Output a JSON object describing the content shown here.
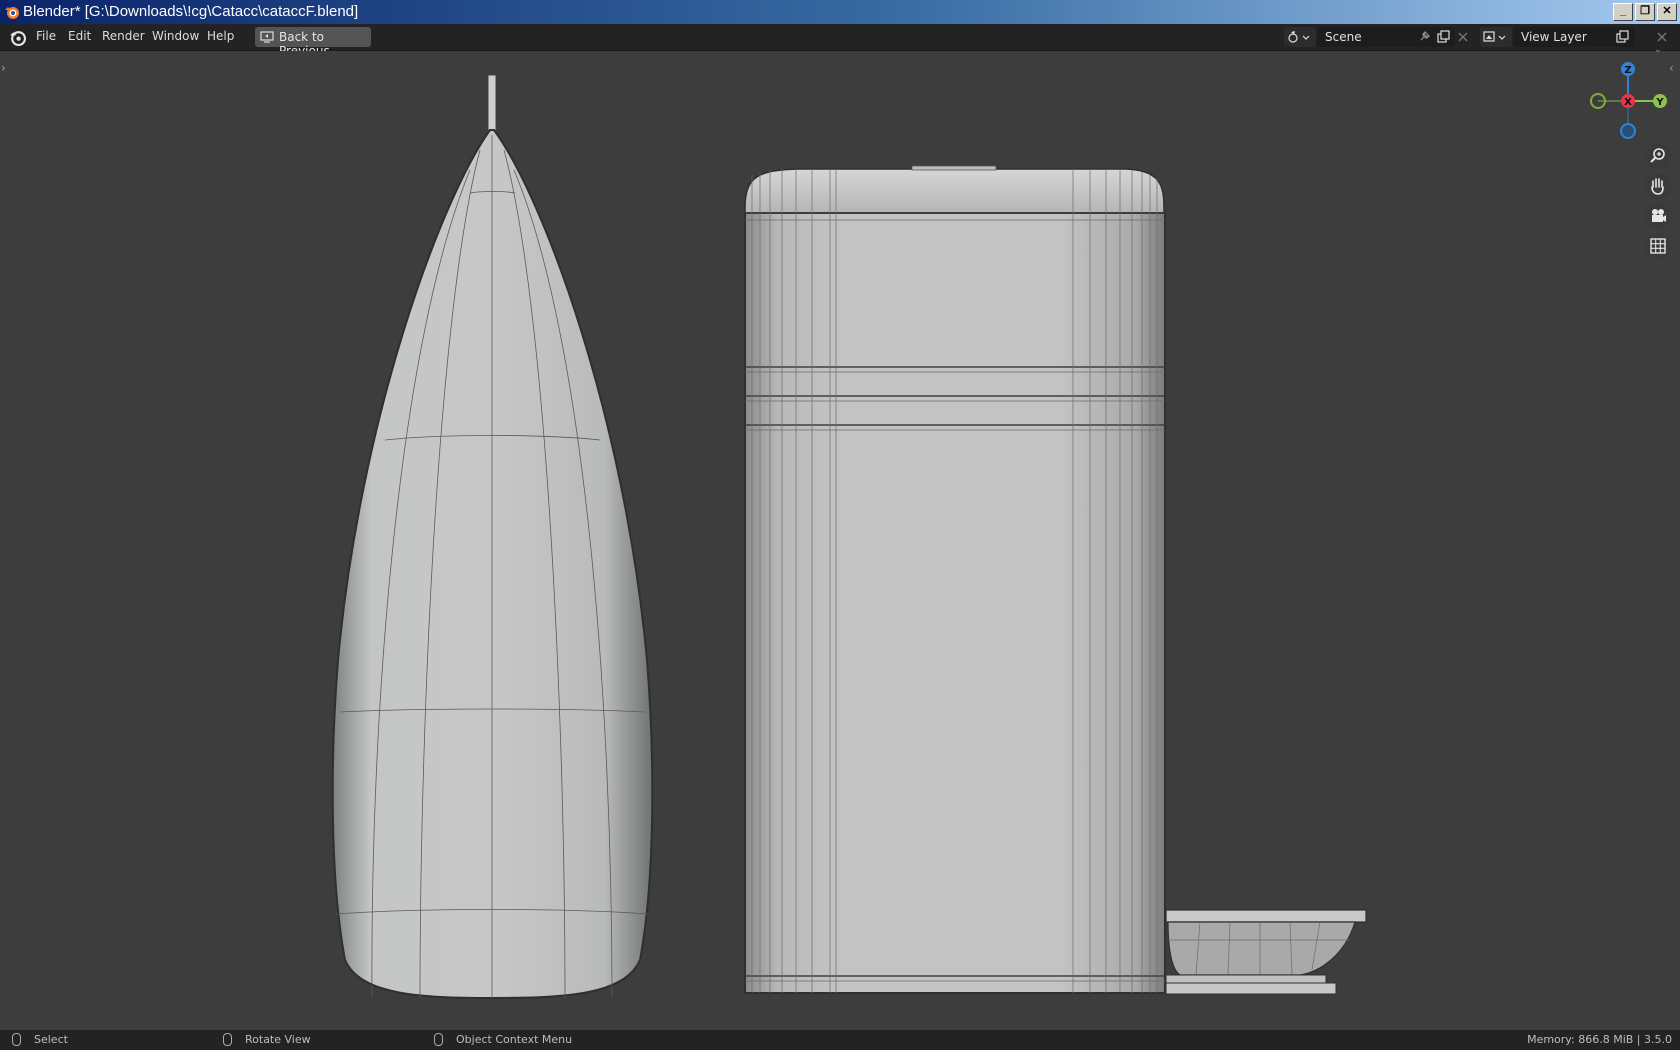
{
  "window": {
    "title": "Blender* [G:\\Downloads\\!cg\\Catacc\\cataccF.blend]",
    "controls": {
      "minimize": "_",
      "restore": "❐",
      "close": "✕"
    }
  },
  "menubar": {
    "items": [
      "File",
      "Edit",
      "Render",
      "Window",
      "Help"
    ],
    "back_button": "Back to Previous",
    "scene": {
      "label": "Scene"
    },
    "view_layer": {
      "label": "View Layer"
    }
  },
  "gizmo": {
    "z": "Z",
    "x": "X",
    "y": "Y"
  },
  "statusbar": {
    "select": "Select",
    "rotate": "Rotate View",
    "context": "Object Context Menu",
    "info": "Memory: 866.8 MiB | 3.5.0"
  },
  "colors": {
    "x_axis": "#e8334a",
    "y_axis": "#8bc34a",
    "z_axis": "#2f84d8",
    "viewport_bg": "#3d3d3d",
    "header_bg": "#232323"
  }
}
